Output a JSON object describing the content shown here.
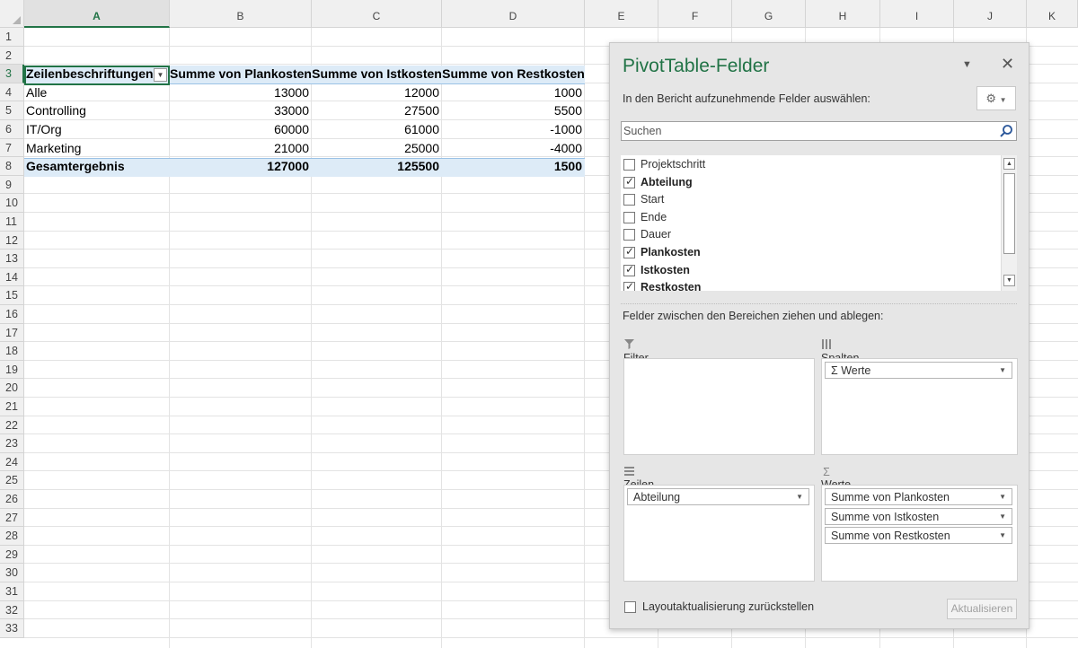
{
  "sheet": {
    "columns": [
      "A",
      "B",
      "C",
      "D",
      "E",
      "F",
      "G",
      "H",
      "I",
      "J",
      "K"
    ],
    "selected_column": "A",
    "selected_row": "3",
    "rows": [
      "1",
      "2",
      "3",
      "4",
      "5",
      "6",
      "7",
      "8",
      "9",
      "10",
      "11",
      "12",
      "13",
      "14",
      "15",
      "16",
      "17",
      "18",
      "19",
      "20",
      "21",
      "22",
      "23",
      "24",
      "25",
      "26",
      "27",
      "28",
      "29",
      "30",
      "31",
      "32",
      "33"
    ],
    "pivot": {
      "headers": [
        "Zeilenbeschriftungen",
        "Summe von Plankosten",
        "Summe von Istkosten",
        "Summe von Restkosten"
      ],
      "rows": [
        {
          "label": "Alle",
          "values": [
            "13000",
            "12000",
            "1000"
          ]
        },
        {
          "label": "Controlling",
          "values": [
            "33000",
            "27500",
            "5500"
          ]
        },
        {
          "label": "IT/Org",
          "values": [
            "60000",
            "61000",
            "-1000"
          ]
        },
        {
          "label": "Marketing",
          "values": [
            "21000",
            "25000",
            "-4000"
          ]
        }
      ],
      "total": {
        "label": "Gesamtergebnis",
        "values": [
          "127000",
          "125500",
          "1500"
        ]
      }
    }
  },
  "pane": {
    "title": "PivotTable-Felder",
    "subtitle": "In den Bericht aufzunehmende Felder auswählen:",
    "search_placeholder": "Suchen",
    "fields": [
      {
        "label": "Projektschritt",
        "checked": false
      },
      {
        "label": "Abteilung",
        "checked": true
      },
      {
        "label": "Start",
        "checked": false
      },
      {
        "label": "Ende",
        "checked": false
      },
      {
        "label": "Dauer",
        "checked": false
      },
      {
        "label": "Plankosten",
        "checked": true
      },
      {
        "label": "Istkosten",
        "checked": true
      },
      {
        "label": "Restkosten",
        "checked": true
      }
    ],
    "drag_label": "Felder zwischen den Bereichen ziehen und ablegen:",
    "areas": {
      "filter": {
        "label": "Filter",
        "items": []
      },
      "columns": {
        "label": "Spalten",
        "items": [
          "Werte"
        ]
      },
      "rows": {
        "label": "Zeilen",
        "items": [
          "Abteilung"
        ]
      },
      "values": {
        "label": "Werte",
        "items": [
          "Summe von Plankosten",
          "Summe von Istkosten",
          "Summe von Restkosten"
        ]
      }
    },
    "defer_label": "Layoutaktualisierung zurückstellen",
    "update_label": "Aktualisieren",
    "icons": [
      "gear-icon",
      "search-icon",
      "filter-icon",
      "columns-icon",
      "rows-icon",
      "sigma-icon",
      "close-icon",
      "chevron-down-icon"
    ]
  }
}
